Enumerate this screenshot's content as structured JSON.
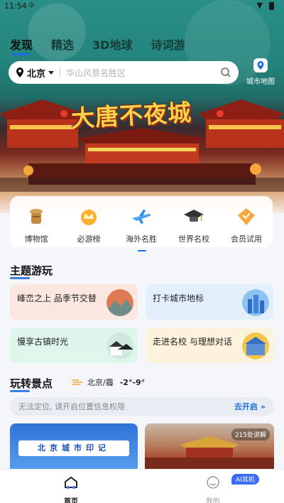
{
  "status": {
    "time": "11:54"
  },
  "tabs": [
    {
      "label": "发现",
      "active": true
    },
    {
      "label": "精选"
    },
    {
      "label": "3D地球"
    },
    {
      "label": "诗词游"
    }
  ],
  "search": {
    "city": "北京",
    "placeholder": "华山风景名胜区"
  },
  "city_map": {
    "label": "城市地图"
  },
  "banner": {
    "title": "大唐不夜城"
  },
  "categories": [
    {
      "label": "博物馆",
      "icon": "museum-icon"
    },
    {
      "label": "必游榜",
      "icon": "crown-icon"
    },
    {
      "label": "海外名胜",
      "icon": "airplane-icon",
      "active": true
    },
    {
      "label": "世界名校",
      "icon": "graduation-cap-icon"
    },
    {
      "label": "会员试用",
      "icon": "vip-icon"
    }
  ],
  "theme_section": {
    "title": "主题游玩",
    "cards": [
      {
        "label": "峰峦之上 品季节交替",
        "bg": "#fbe7df"
      },
      {
        "label": "打卡城市地标",
        "bg": "#e3f0fc"
      },
      {
        "label": "慢享古镇时光",
        "bg": "#dff6ec"
      },
      {
        "label": "走进名校 与理想对话",
        "bg": "#fdf3dc"
      }
    ]
  },
  "scenic_section": {
    "title": "玩转景点",
    "weather_location": "北京/霾",
    "weather_temp": "-2°-9°",
    "location_message": "无法定位, 请开启位置信息权限",
    "enable_label": "去开启",
    "cards": [
      {
        "title": "北京城市印记"
      },
      {
        "badge": "215处讲解"
      }
    ]
  },
  "bottom_nav": [
    {
      "label": "首页",
      "active": true
    },
    {
      "label": "我的",
      "badge": "AI耳机"
    }
  ]
}
